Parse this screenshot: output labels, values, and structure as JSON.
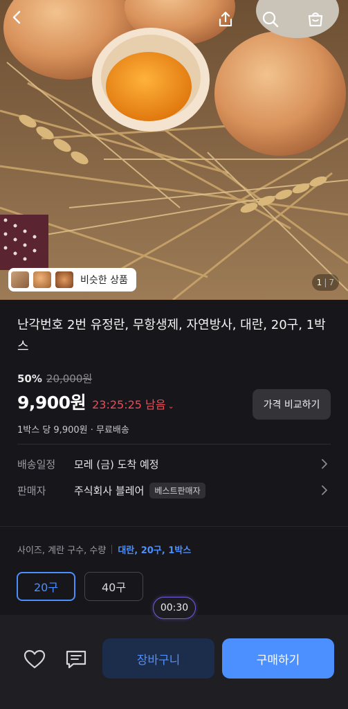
{
  "hero": {
    "image_alt": "eggs on straw nest",
    "counter": {
      "current": "1",
      "separator": "|",
      "total": "7"
    },
    "similar_label": "비슷한 상품"
  },
  "header_icons": [
    "back-icon",
    "share-icon",
    "search-icon",
    "shopping-bag-icon"
  ],
  "product": {
    "title": "난각번호 2번 유정란, 무항생제, 자연방사, 대란, 20구, 1박스",
    "discount": "50%",
    "original_price": "20,000원",
    "price": "9,900원",
    "countdown": "23:25:25 남음",
    "compare_label": "가격 비교하기",
    "unit_info": "1박스 당 9,900원 · 무료배송"
  },
  "delivery": {
    "label": "배송일정",
    "value": "모레 (금) 도착 예정"
  },
  "seller": {
    "label": "판매자",
    "value": "주식회사 블레어",
    "badge": "베스트판매자"
  },
  "options": {
    "header": "사이즈, 계란 구수, 수량",
    "selected_summary": "대란, 20구, 1박스",
    "choices": [
      {
        "label": "20구",
        "selected": true
      },
      {
        "label": "40구",
        "selected": false
      }
    ]
  },
  "timer": "00:30",
  "bottom": {
    "cart_label": "장바구니",
    "buy_label": "구매하기"
  },
  "colors": {
    "accent": "#4c8fff",
    "countdown": "#ef4b57",
    "background": "#17171b"
  }
}
